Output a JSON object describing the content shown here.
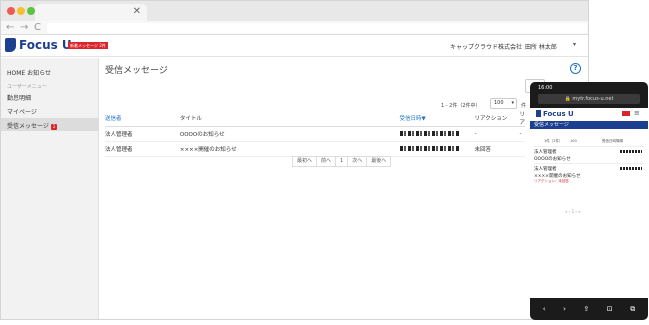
{
  "browser": {
    "tab_close": "✕",
    "nav": [
      "←",
      "→",
      "C"
    ]
  },
  "header": {
    "logo": "Focus U",
    "badge": "新着メッセージ 2件",
    "company": "キャップクラウド株式会社",
    "user": "田所 林太郎",
    "caret": "▾"
  },
  "sidebar": {
    "home": "HOME お知らせ",
    "section": "ユーザーメニュー",
    "items": [
      {
        "label": "勤怠明細"
      },
      {
        "label": "マイページ"
      },
      {
        "label": "受信メッセージ",
        "badge": "2"
      }
    ]
  },
  "main": {
    "title": "受信メッセージ",
    "help": "?",
    "page_count": "1 - 2件（2件中）",
    "per_page": "100",
    "per_page_unit": "件",
    "columns": [
      "送信者",
      "タイトル",
      "受信日時▼",
      "リアクション",
      "リア"
    ],
    "rows": [
      {
        "sender": "法人管理者",
        "title": "OOOOのお知らせ",
        "reaction": "-",
        "reaction2": "-"
      },
      {
        "sender": "法人管理者",
        "title": "××××開催のお知らせ",
        "reaction": "未回答",
        "reaction2": ""
      }
    ],
    "pager": [
      "最初へ",
      "前へ",
      "1",
      "次へ",
      "最後へ"
    ]
  },
  "phone": {
    "time": "16:00",
    "url": "🔒 mytr.focus-u.net",
    "logo": "Focus U",
    "menu": "≡",
    "bar": "受信メッセージ",
    "ctrl_count": "1件（2件）",
    "ctrl_perpage": "100",
    "ctrl_sort": "受信日時降順",
    "rows": [
      {
        "sender": "法人管理者",
        "title": "OOOOのお知らせ",
        "note": ""
      },
      {
        "sender": "法人管理者",
        "title": "××××開催のお知らせ",
        "note": "リアクション：未回答"
      }
    ],
    "pager": "« ‹ 1 › »",
    "bottom": [
      "‹",
      "›",
      "⇪",
      "⊡",
      "⧉"
    ]
  },
  "colors": {
    "brand": "#1d3f8f",
    "accent": "#1a73c9",
    "alert": "#d9262c"
  }
}
